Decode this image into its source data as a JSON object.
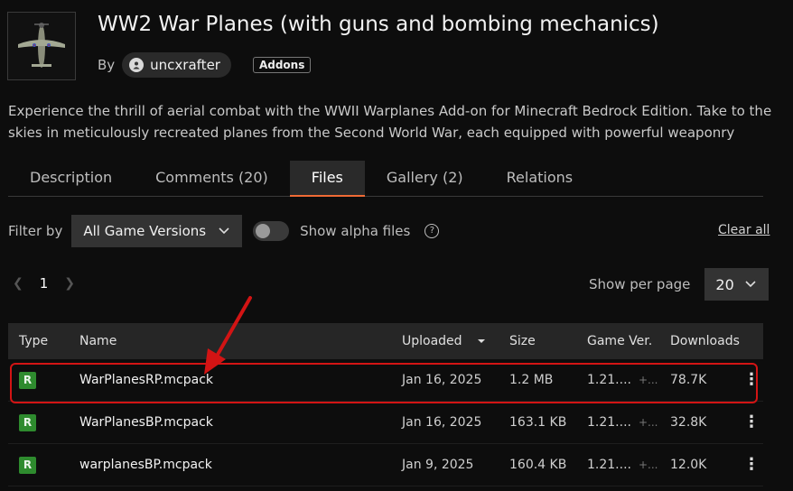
{
  "project": {
    "title": "WW2 War Planes (with guns and bombing mechanics)",
    "by_label": "By",
    "author": "uncxrafter",
    "tag": "Addons",
    "description": "Experience the thrill of aerial combat with the WWII Warplanes Add-on for Minecraft Bedrock Edition. Take to the skies in meticulously recreated planes from the Second World War, each equipped with powerful weaponry"
  },
  "tabs": [
    {
      "label": "Description",
      "active": false
    },
    {
      "label": "Comments (20)",
      "active": false
    },
    {
      "label": "Files",
      "active": true
    },
    {
      "label": "Gallery (2)",
      "active": false
    },
    {
      "label": "Relations",
      "active": false
    }
  ],
  "filters": {
    "filter_label": "Filter by",
    "game_version": "All Game Versions",
    "alpha_label": "Show alpha files",
    "clear_label": "Clear all"
  },
  "pagination": {
    "current_page": "1",
    "per_page_label": "Show per page",
    "per_page_value": "20"
  },
  "table": {
    "headers": {
      "type": "Type",
      "name": "Name",
      "uploaded": "Uploaded",
      "size": "Size",
      "game_ver": "Game Ver.",
      "downloads": "Downloads"
    },
    "rows": [
      {
        "type": "R",
        "name": "WarPlanesRP.mcpack",
        "uploaded": "Jan 16, 2025",
        "size": "1.2 MB",
        "game_ver": "1.21....",
        "more": "+...",
        "downloads": "78.7K",
        "highlighted": true
      },
      {
        "type": "R",
        "name": "WarPlanesBP.mcpack",
        "uploaded": "Jan 16, 2025",
        "size": "163.1 KB",
        "game_ver": "1.21....",
        "more": "+...",
        "downloads": "32.8K",
        "highlighted": false
      },
      {
        "type": "R",
        "name": "warplanesBP.mcpack",
        "uploaded": "Jan 9, 2025",
        "size": "160.4 KB",
        "game_ver": "1.21....",
        "more": "+...",
        "downloads": "12.0K",
        "highlighted": false
      }
    ]
  },
  "colors": {
    "accent_tab": "#f06a35",
    "release_badge": "#2e8b2e",
    "highlight_annotation": "#d21414"
  },
  "icons": [
    "warplane-thumbnail",
    "user-icon",
    "chevron-down-icon",
    "help-icon",
    "chevron-left-icon",
    "chevron-right-icon",
    "sort-down-icon",
    "kebab-menu-icon",
    "red-arrow-annotation"
  ]
}
